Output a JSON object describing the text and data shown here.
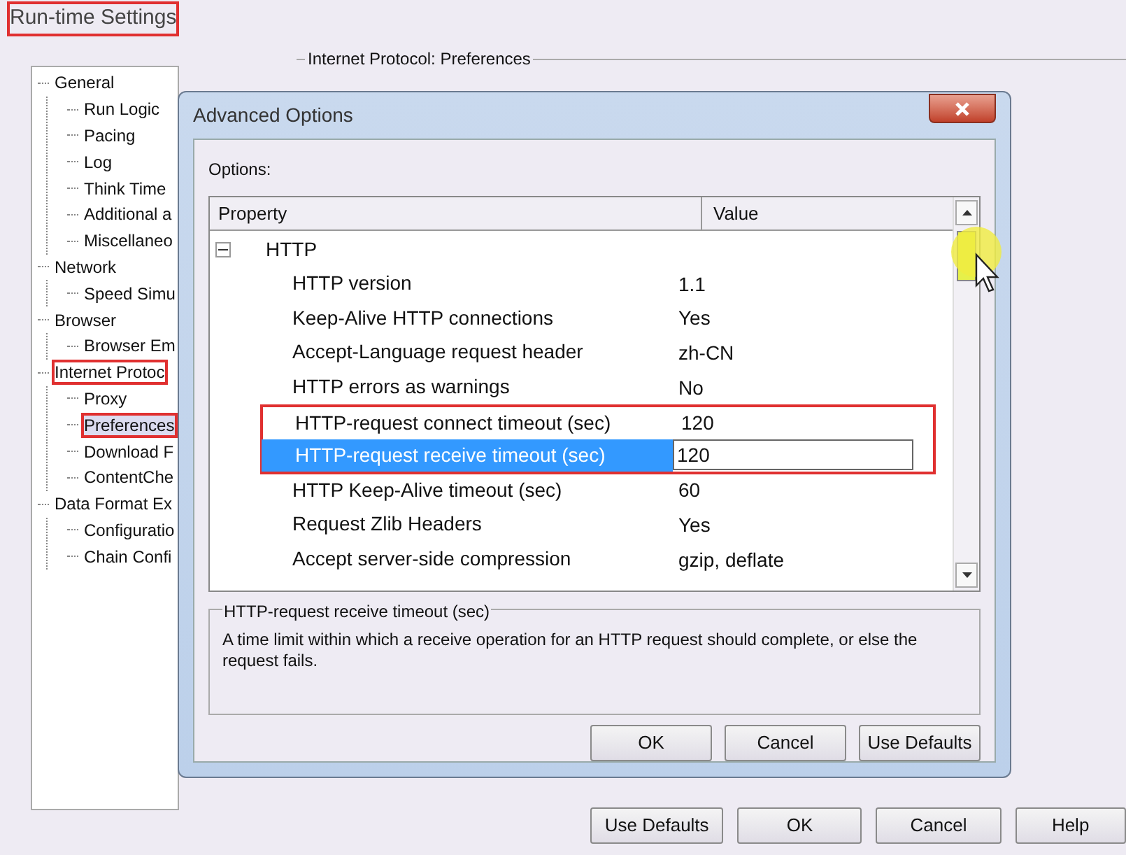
{
  "window": {
    "title": "Run-time Settings",
    "title_annotated": true
  },
  "tree": [
    {
      "label": "General",
      "selected": false,
      "annotated": false,
      "children": [
        {
          "label": "Run Logic",
          "selected": false,
          "annotated": false
        },
        {
          "label": "Pacing",
          "selected": false,
          "annotated": false
        },
        {
          "label": "Log",
          "selected": false,
          "annotated": false
        },
        {
          "label": "Think Time",
          "selected": false,
          "annotated": false
        },
        {
          "label": "Additional a",
          "selected": false,
          "annotated": false
        },
        {
          "label": "Miscellaneo",
          "selected": false,
          "annotated": false
        }
      ]
    },
    {
      "label": "Network",
      "selected": false,
      "annotated": false,
      "children": [
        {
          "label": "Speed Simu",
          "selected": false,
          "annotated": false
        }
      ]
    },
    {
      "label": "Browser",
      "selected": false,
      "annotated": false,
      "children": [
        {
          "label": "Browser Em",
          "selected": false,
          "annotated": false
        }
      ]
    },
    {
      "label": "Internet Protoc",
      "selected": false,
      "annotated": true,
      "children": [
        {
          "label": "Proxy",
          "selected": false,
          "annotated": false
        },
        {
          "label": "Preferences",
          "selected": true,
          "annotated": true
        },
        {
          "label": "Download F",
          "selected": false,
          "annotated": false
        },
        {
          "label": "ContentChe",
          "selected": false,
          "annotated": false
        }
      ]
    },
    {
      "label": "Data Format Ex",
      "selected": false,
      "annotated": false,
      "children": [
        {
          "label": "Configuratio",
          "selected": false,
          "annotated": false
        },
        {
          "label": "Chain Confi",
          "selected": false,
          "annotated": false
        }
      ]
    }
  ],
  "group_title": "Internet Protocol: Preferences",
  "main_buttons": [
    "Use Defaults",
    "OK",
    "Cancel",
    "Help"
  ],
  "dialog": {
    "title": "Advanced Options",
    "options_label": "Options:",
    "columns": [
      "Property",
      "Value"
    ],
    "group": {
      "label": "HTTP",
      "expanded": true
    },
    "rows": [
      {
        "property": "HTTP version",
        "value": "1.1",
        "selected": false,
        "annotated": false
      },
      {
        "property": "Keep-Alive HTTP connections",
        "value": "Yes",
        "selected": false,
        "annotated": false
      },
      {
        "property": "Accept-Language request header",
        "value": "zh-CN",
        "selected": false,
        "annotated": false
      },
      {
        "property": "HTTP errors as warnings",
        "value": "No",
        "selected": false,
        "annotated": false
      },
      {
        "property": "HTTP-request connect timeout (sec)",
        "value": "120",
        "selected": false,
        "annotated": true
      },
      {
        "property": "HTTP-request receive timeout (sec)",
        "value": "120",
        "selected": true,
        "annotated": true
      },
      {
        "property": "HTTP Keep-Alive timeout (sec)",
        "value": "60",
        "selected": false,
        "annotated": false
      },
      {
        "property": "Request Zlib Headers",
        "value": "Yes",
        "selected": false,
        "annotated": false
      },
      {
        "property": "Accept server-side compression",
        "value": "gzip, deflate",
        "selected": false,
        "annotated": false
      }
    ],
    "description_title": "HTTP-request receive timeout (sec)",
    "description": "A time limit within which a receive operation for an HTTP request should complete, or else the request fails.",
    "buttons": [
      "OK",
      "Cancel",
      "Use Defaults"
    ]
  }
}
